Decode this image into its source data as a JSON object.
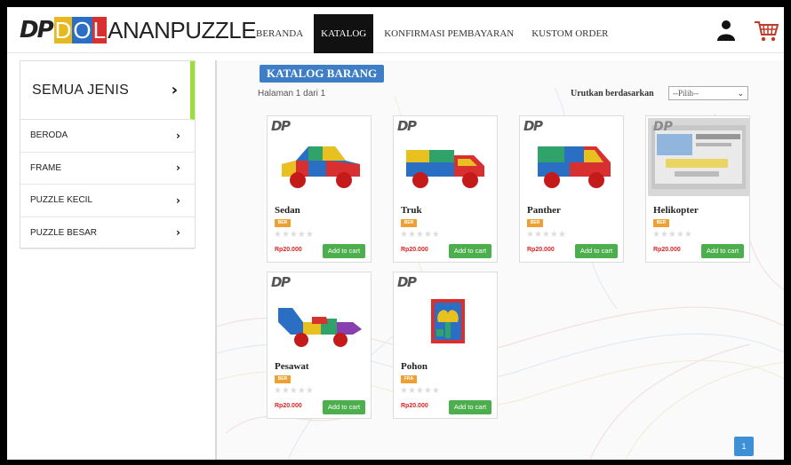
{
  "header": {
    "logo": {
      "dp": "DP",
      "blocks": [
        "D",
        "O",
        "L"
      ],
      "rest": "ANANPUZZLE",
      "block_colors": [
        "#e8b820",
        "#2a6fc4",
        "#d83030"
      ]
    },
    "nav": [
      {
        "label": "BERANDA",
        "active": false
      },
      {
        "label": "KATALOG",
        "active": true
      },
      {
        "label": "KONFIRMASI PEMBAYARAN",
        "active": false
      },
      {
        "label": "KUSTOM ORDER",
        "active": false
      }
    ],
    "icons": {
      "user": "user-icon",
      "cart": "shopping-cart-icon"
    }
  },
  "sidebar": {
    "heading": "SEMUA JENIS",
    "items": [
      {
        "label": "BERODA"
      },
      {
        "label": "FRAME"
      },
      {
        "label": "PUZZLE KECIL"
      },
      {
        "label": "PUZZLE BESAR"
      }
    ],
    "accent_color": "#9be03a"
  },
  "catalog": {
    "title": "KATALOG BARANG",
    "page_info": "Halaman 1 dari 1",
    "sort_label": "Urutkan berdasarkan",
    "sort_value": "--Pilih--",
    "products": [
      {
        "name": "Sedan",
        "badge": "BER",
        "price": "Rp20.000",
        "button": "Add to cart",
        "image": "puzzle-car",
        "rating": 0,
        "brand": "DP"
      },
      {
        "name": "Truk",
        "badge": "BER",
        "price": "Rp20.000",
        "button": "Add to cart",
        "image": "puzzle-truck",
        "rating": 0,
        "brand": "DP"
      },
      {
        "name": "Panther",
        "badge": "BER",
        "price": "Rp20.000",
        "button": "Add to cart",
        "image": "puzzle-van",
        "rating": 0,
        "brand": "DP"
      },
      {
        "name": "Helikopter",
        "badge": "BER",
        "price": "Rp20.000",
        "button": "Add to cart",
        "image": "screenshot-placeholder",
        "rating": 0,
        "brand": "DP"
      },
      {
        "name": "Pesawat",
        "badge": "BER",
        "price": "Rp20.000",
        "button": "Add to cart",
        "image": "puzzle-plane",
        "rating": 0,
        "brand": "DP"
      },
      {
        "name": "Pohon",
        "badge": "FRA",
        "price": "Rp20.000",
        "button": "Add to cart",
        "image": "puzzle-tree-frame",
        "rating": 0,
        "brand": "DP"
      }
    ],
    "pagination": {
      "current": "1"
    },
    "colors": {
      "title_bg": "#3d7ec6",
      "button": "#4cae4c",
      "price": "#d22",
      "badge": "#f0a030",
      "page": "#3d8fd6"
    }
  }
}
